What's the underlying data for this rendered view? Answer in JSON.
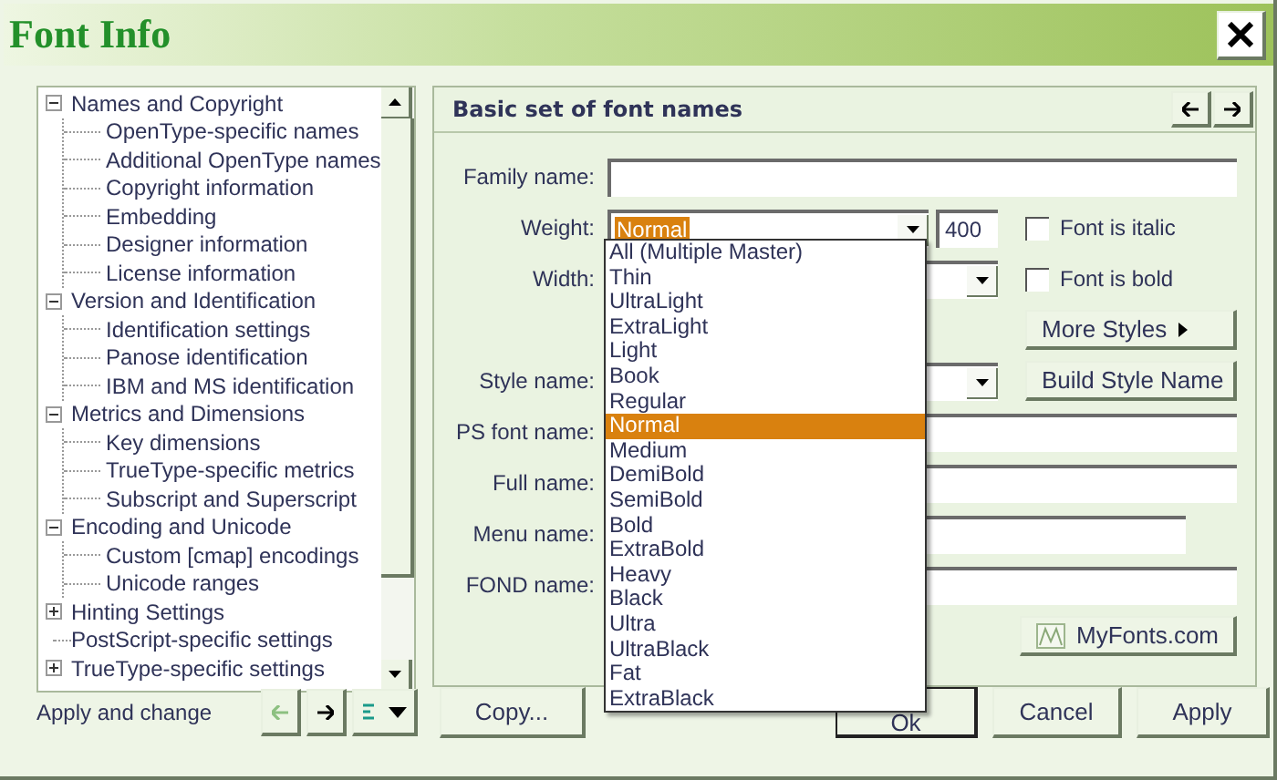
{
  "window": {
    "title": "Font Info"
  },
  "tree": {
    "items": [
      {
        "label": "Names and Copyright",
        "expanded": true,
        "children": [
          {
            "label": "OpenType-specific names"
          },
          {
            "label": "Additional OpenType names"
          },
          {
            "label": "Copyright information"
          },
          {
            "label": "Embedding"
          },
          {
            "label": "Designer information"
          },
          {
            "label": "License information"
          }
        ]
      },
      {
        "label": "Version and Identification",
        "expanded": true,
        "children": [
          {
            "label": "Identification settings"
          },
          {
            "label": "Panose identification"
          },
          {
            "label": "IBM and MS identification"
          }
        ]
      },
      {
        "label": "Metrics and Dimensions",
        "expanded": true,
        "children": [
          {
            "label": "Key dimensions"
          },
          {
            "label": "TrueType-specific metrics"
          },
          {
            "label": "Subscript and Superscript"
          }
        ]
      },
      {
        "label": "Encoding and Unicode",
        "expanded": true,
        "children": [
          {
            "label": "Custom [cmap] encodings"
          },
          {
            "label": "Unicode ranges"
          }
        ]
      },
      {
        "label": "Hinting Settings",
        "expanded": false
      },
      {
        "label": "PostScript-specific settings"
      },
      {
        "label": "TrueType-specific settings",
        "expanded": false
      }
    ]
  },
  "panel": {
    "title": "Basic set of font names",
    "fields": [
      {
        "label": "Family name:",
        "kind": "text"
      },
      {
        "label": "Weight:",
        "kind": "combo",
        "value": "Normal",
        "number": "400"
      },
      {
        "label": "Width:",
        "kind": "combo"
      },
      {
        "label": "Style name:",
        "kind": "combo"
      },
      {
        "label": "PS font name:",
        "kind": "text"
      },
      {
        "label": "Full name:",
        "kind": "text"
      },
      {
        "label": "Menu name:",
        "kind": "short"
      },
      {
        "label": "FOND name:",
        "kind": "text"
      }
    ],
    "checkboxes": [
      {
        "label": "Font is italic",
        "checked": false
      },
      {
        "label": "Font is bold",
        "checked": false
      }
    ],
    "more_styles": "More Styles",
    "build_style": "Build Style Name",
    "myfonts": "MyFonts.com"
  },
  "weight_dropdown": {
    "options": [
      {
        "label": "All (Multiple Master)",
        "selected": false
      },
      {
        "label": "Thin",
        "selected": false
      },
      {
        "label": "UltraLight",
        "selected": false
      },
      {
        "label": "ExtraLight",
        "selected": false
      },
      {
        "label": "Light",
        "selected": false
      },
      {
        "label": "Book",
        "selected": false
      },
      {
        "label": "Regular",
        "selected": false
      },
      {
        "label": "Normal",
        "selected": true
      },
      {
        "label": "Medium",
        "selected": false
      },
      {
        "label": "DemiBold",
        "selected": false
      },
      {
        "label": "SemiBold",
        "selected": false
      },
      {
        "label": "Bold",
        "selected": false
      },
      {
        "label": "ExtraBold",
        "selected": false
      },
      {
        "label": "Heavy",
        "selected": false
      },
      {
        "label": "Black",
        "selected": false
      },
      {
        "label": "Ultra",
        "selected": false
      },
      {
        "label": "UltraBlack",
        "selected": false
      },
      {
        "label": "Fat",
        "selected": false
      },
      {
        "label": "ExtraBlack",
        "selected": false
      }
    ]
  },
  "footer": {
    "hint": "Apply and change",
    "nav": [
      {
        "kind": "back",
        "disabled": true
      },
      {
        "kind": "forward",
        "disabled": false
      },
      {
        "kind": "menu",
        "disabled": false
      }
    ],
    "buttons": [
      {
        "label": "Copy...",
        "kind": "copy"
      },
      {
        "label": "Ok",
        "kind": "default"
      },
      {
        "label": "Cancel",
        "kind": "normal"
      },
      {
        "label": "Apply",
        "kind": "normal"
      }
    ]
  }
}
